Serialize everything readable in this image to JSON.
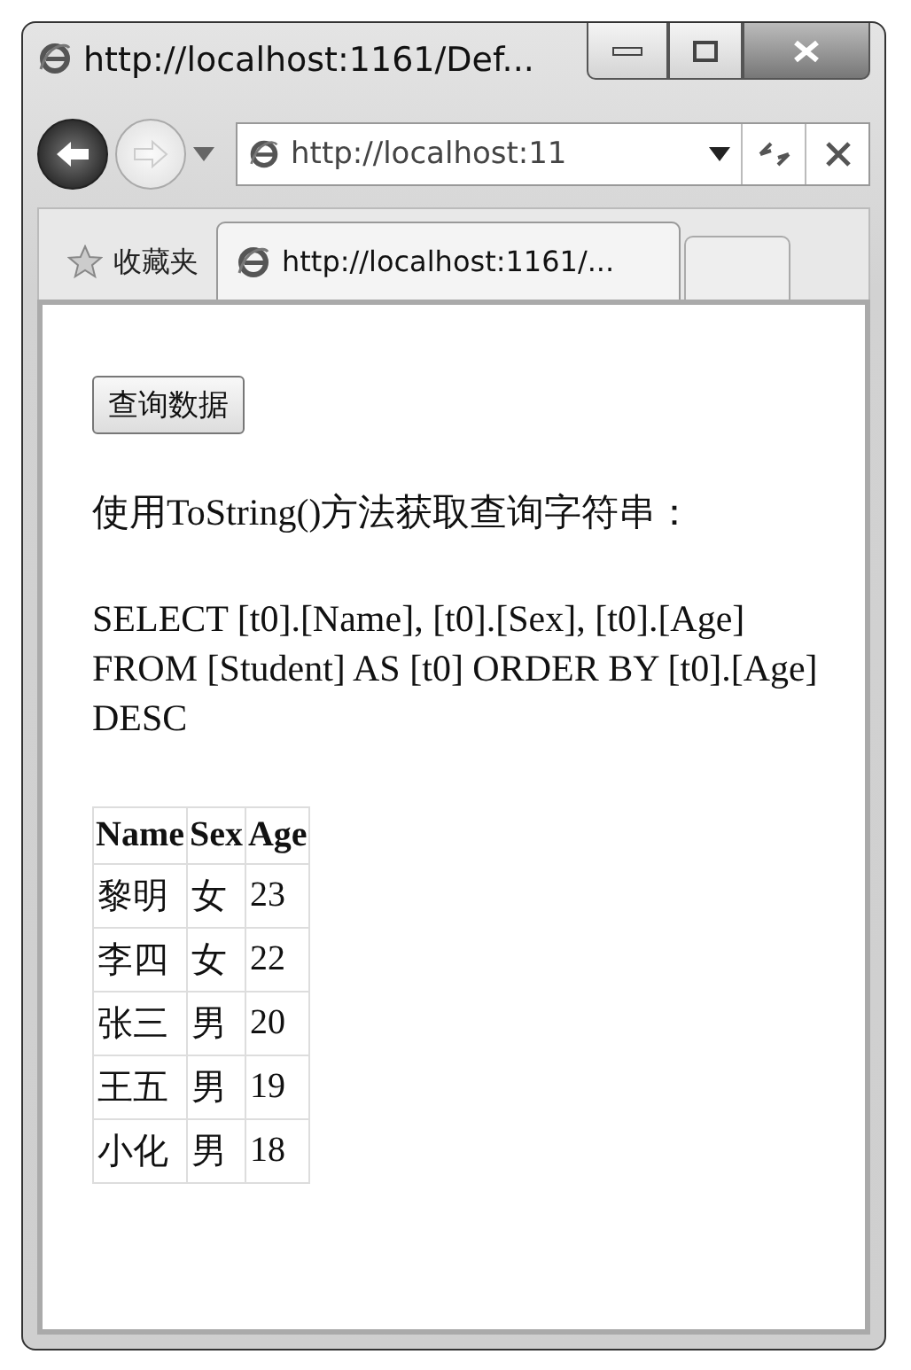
{
  "window": {
    "title": "http://localhost:1161/Def..."
  },
  "address_bar": {
    "url": "http://localhost:11"
  },
  "favorites": {
    "label": "收藏夹"
  },
  "tabs": [
    {
      "label": "http://localhost:1161/...",
      "selected": true
    }
  ],
  "page": {
    "button": "查询数据",
    "caption": "使用ToString()方法获取查询字符串：",
    "query": "SELECT [t0].[Name], [t0].[Sex], [t0].[Age] FROM [Student] AS [t0] ORDER BY [t0].[Age] DESC",
    "table": {
      "columns": [
        "Name",
        "Sex",
        "Age"
      ],
      "rows": [
        [
          "黎明",
          "女",
          "23"
        ],
        [
          "李四",
          "女",
          "22"
        ],
        [
          "张三",
          "男",
          "20"
        ],
        [
          "王五",
          "男",
          "19"
        ],
        [
          "小化",
          "男",
          "18"
        ]
      ]
    }
  }
}
